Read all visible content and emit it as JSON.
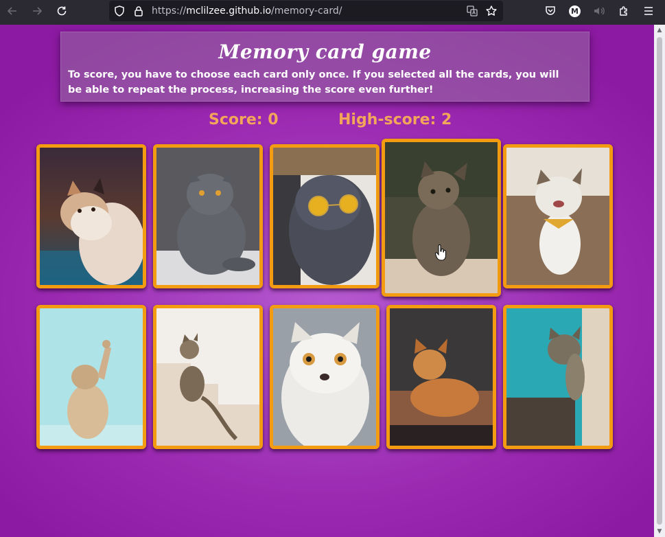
{
  "browser": {
    "url_prefix": "https://",
    "url_host": "mclilzee.github.io",
    "url_path": "/memory-card/",
    "profile_letter": "M"
  },
  "header": {
    "title": "Memory card game",
    "description": "To score, you have to choose each card only once. If you selected all the cards, you will be able to repeat the process, increasing the score even further!"
  },
  "scoreboard": {
    "score_label": "Score: 0",
    "highscore_label": "High-score: 2"
  },
  "colors": {
    "card_border": "#f39c12",
    "score_text": "#f2a65a",
    "background": "#9a22a8"
  }
}
